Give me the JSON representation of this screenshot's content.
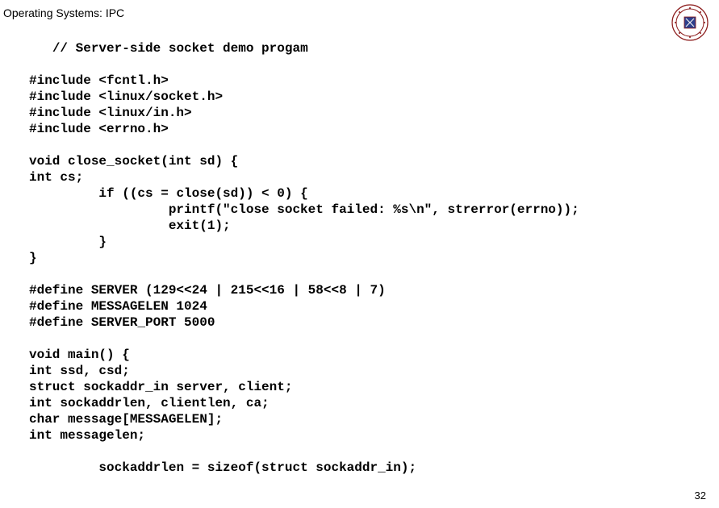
{
  "header": {
    "title": "Operating Systems: IPC"
  },
  "slide_number": "32",
  "code": {
    "line1": "   // Server-side socket demo progam",
    "line2": "",
    "line3": "#include <fcntl.h>",
    "line4": "#include <linux/socket.h>",
    "line5": "#include <linux/in.h>",
    "line6": "#include <errno.h>",
    "line7": "",
    "line8": "void close_socket(int sd) {",
    "line9": "int cs;",
    "line10": "         if ((cs = close(sd)) < 0) {",
    "line11": "                  printf(\"close socket failed: %s\\n\", strerror(errno));",
    "line12": "                  exit(1);",
    "line13": "         }",
    "line14": "}",
    "line15": "",
    "line16": "#define SERVER (129<<24 | 215<<16 | 58<<8 | 7)",
    "line17": "#define MESSAGELEN 1024",
    "line18": "#define SERVER_PORT 5000",
    "line19": "",
    "line20": "void main() {",
    "line21": "int ssd, csd;",
    "line22": "struct sockaddr_in server, client;",
    "line23": "int sockaddrlen, clientlen, ca;",
    "line24": "char message[MESSAGELEN];",
    "line25": "int messagelen;",
    "line26": "",
    "line27": "         sockaddrlen = sizeof(struct sockaddr_in);"
  }
}
